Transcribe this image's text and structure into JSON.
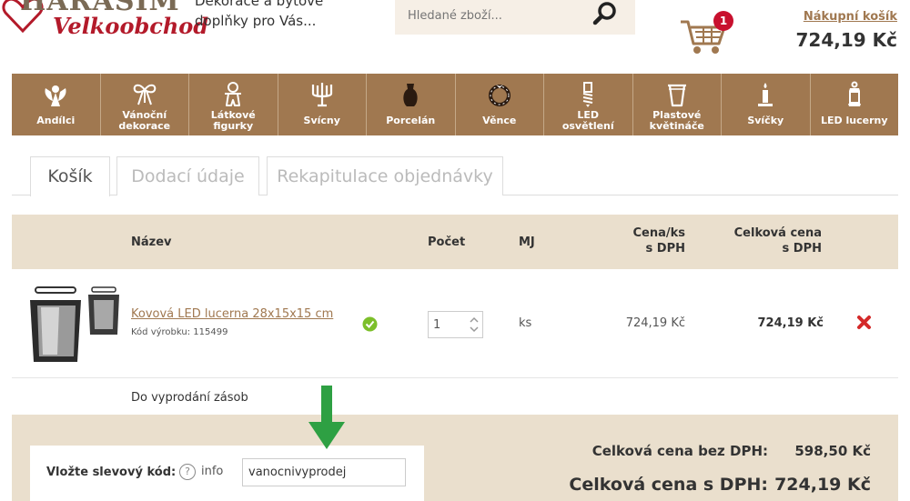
{
  "header": {
    "logo_brand": "HARASIM",
    "logo_sub": "Velkoobchod",
    "tagline": "Dekorace a bytové doplňky pro Vás...",
    "search_placeholder": "Hledané zboží...",
    "cart_count": "1",
    "cart_link": "Nákupní košík",
    "cart_total": "724,19 Kč"
  },
  "categories": [
    {
      "label": "Andílci",
      "icon": "angel-icon"
    },
    {
      "label": "Vánoční\ndekorace",
      "icon": "bow-icon"
    },
    {
      "label": "Látkové\nfigurky",
      "icon": "gingerbread-icon"
    },
    {
      "label": "Svícny",
      "icon": "candelabra-icon"
    },
    {
      "label": "Porcelán",
      "icon": "vase-icon"
    },
    {
      "label": "Věnce",
      "icon": "wreath-icon"
    },
    {
      "label": "LED\nosvětlení",
      "icon": "bulb-icon"
    },
    {
      "label": "Plastové\nkvětináče",
      "icon": "flowerpot-icon"
    },
    {
      "label": "Svíčky",
      "icon": "candle-icon"
    },
    {
      "label": "LED lucerny",
      "icon": "lantern-icon"
    }
  ],
  "tabs": [
    {
      "label": "Košík",
      "active": true
    },
    {
      "label": "Dodací údaje",
      "active": false
    },
    {
      "label": "Rekapitulace objednávky",
      "active": false
    }
  ],
  "table": {
    "headers": {
      "name": "Název",
      "qty": "Počet",
      "unit": "MJ",
      "price_unit": "Cena/ks\ns DPH",
      "price_total": "Celková cena\ns DPH"
    },
    "rows": [
      {
        "name": "Kovová LED lucerna 28x15x15 cm",
        "code": "Kód výrobku: 115499",
        "qty": "1",
        "unit": "ks",
        "price_unit": "724,19 Kč",
        "price_total": "724,19 Kč"
      }
    ],
    "stock_note": "Do vyprodání zásob"
  },
  "summary": {
    "coupon_label": "Vložte slevový kód:",
    "info_icon": "?",
    "info_label": "info",
    "coupon_value": "vanocnivyprodej",
    "total_no_vat_label": "Celková cena bez DPH:",
    "total_no_vat": "598,50 Kč",
    "total_vat_label": "Celková cena s DPH:",
    "total_vat": "724,19 Kč"
  },
  "colors": {
    "brand_brown": "#a07850",
    "header_beige": "#eadfcd",
    "badge_red": "#c8102e",
    "ok_green": "#7cbf2a",
    "arrow_green": "#2ea043"
  }
}
